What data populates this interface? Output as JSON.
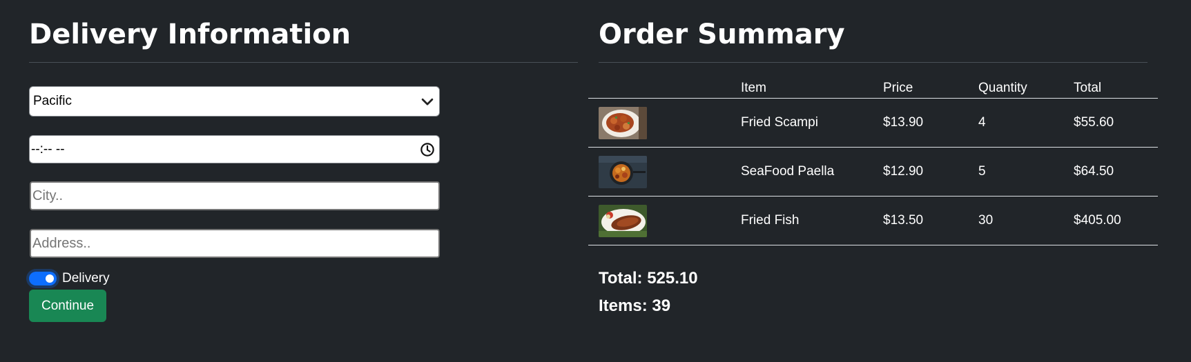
{
  "delivery": {
    "title": "Delivery Information",
    "region_select": {
      "value": "Pacific"
    },
    "time_input": {
      "value": "--:-- --"
    },
    "city_input": {
      "placeholder": "City.."
    },
    "address_input": {
      "placeholder": "Address.."
    },
    "delivery_toggle": {
      "label": "Delivery",
      "checked": true
    },
    "continue_button": "Continue"
  },
  "order": {
    "title": "Order Summary",
    "columns": [
      "",
      "Item",
      "Price",
      "Quantity",
      "Total"
    ],
    "rows": [
      {
        "thumbnail": "fried-scampi-image",
        "item": "Fried Scampi",
        "price": "$13.90",
        "quantity": "4",
        "total": "$55.60"
      },
      {
        "thumbnail": "seafood-paella-image",
        "item": "SeaFood Paella",
        "price": "$12.90",
        "quantity": "5",
        "total": "$64.50"
      },
      {
        "thumbnail": "fried-fish-image",
        "item": "Fried Fish",
        "price": "$13.50",
        "quantity": "30",
        "total": "$405.00"
      }
    ],
    "total_text": "Total: 525.10",
    "items_text": "Items: 39"
  },
  "colors": {
    "background": "#212529",
    "toggle_on": "#0d6efd",
    "continue_button": "#198754"
  }
}
